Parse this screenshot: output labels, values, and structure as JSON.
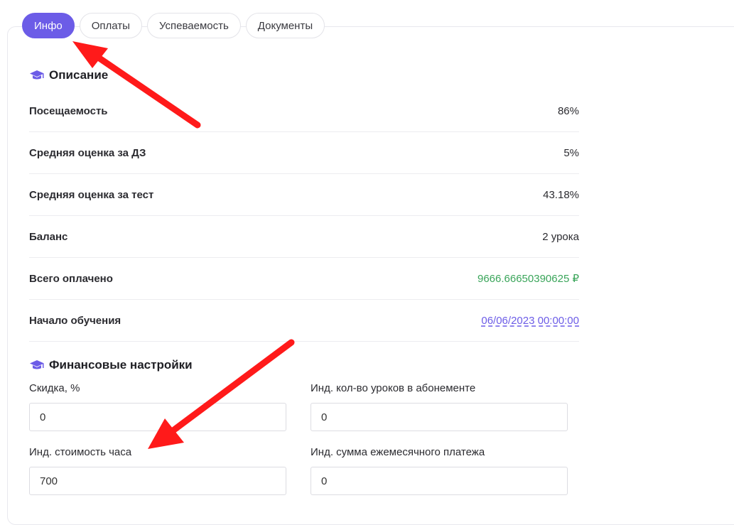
{
  "tabs": [
    {
      "label": "Инфо",
      "active": true
    },
    {
      "label": "Оплаты",
      "active": false
    },
    {
      "label": "Успеваемость",
      "active": false
    },
    {
      "label": "Документы",
      "active": false
    }
  ],
  "description": {
    "title": "Описание",
    "icon": "graduation-cap-icon",
    "rows": [
      {
        "label": "Посещаемость",
        "value": "86%"
      },
      {
        "label": "Средняя оценка за ДЗ",
        "value": "5%"
      },
      {
        "label": "Средняя оценка за тест",
        "value": "43.18%"
      },
      {
        "label": "Баланс",
        "value": "2 урока"
      },
      {
        "label": "Всего оплачено",
        "value": "9666.66650390625 ₽"
      },
      {
        "label": "Начало обучения",
        "value": "06/06/2023 00:00:00"
      }
    ]
  },
  "finance": {
    "title": "Финансовые настройки",
    "icon": "graduation-cap-icon",
    "fields": [
      {
        "label": "Скидка, %",
        "value": "0"
      },
      {
        "label": "Инд. кол-во уроков в абонементе",
        "value": "0"
      },
      {
        "label": "Инд. стоимость часа",
        "value": "700"
      },
      {
        "label": "Инд. сумма ежемесячного платежа",
        "value": "0"
      }
    ]
  },
  "colors": {
    "accent": "#6c5ce7",
    "paid_green": "#3aa55a",
    "annotation_arrow": "#ff1a1a"
  }
}
